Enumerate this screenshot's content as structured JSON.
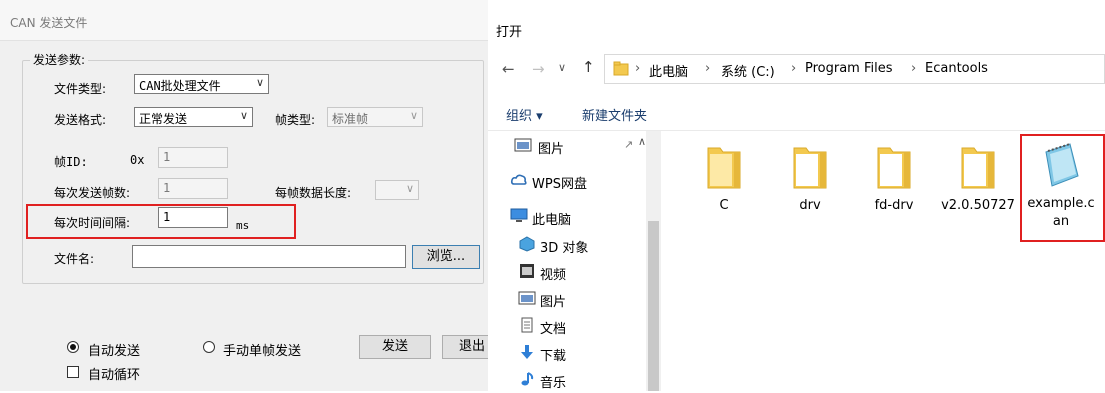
{
  "can_dialog": {
    "title": "CAN 发送文件",
    "group_title": "发送参数:",
    "file_type_label": "文件类型:",
    "file_type_value": "CAN批处理文件",
    "send_format_label": "发送格式:",
    "send_format_value": "正常发送",
    "frame_type_label": "帧类型:",
    "frame_type_value": "标准帧",
    "frame_id_label": "帧ID:",
    "frame_id_prefix": "0x",
    "frame_id_value": "1",
    "frames_per_send_label": "每次发送帧数:",
    "frames_per_send_value": "1",
    "frame_data_len_label": "每帧数据长度:",
    "interval_label": "每次时间间隔:",
    "interval_value": "1",
    "interval_unit": "ms",
    "filename_label": "文件名:",
    "filename_value": "",
    "browse_label": "浏览...",
    "auto_send_label": "自动发送",
    "manual_send_label": "手动单帧发送",
    "auto_loop_label": "自动循环",
    "send_button": "发送",
    "exit_button": "退出"
  },
  "open_dialog": {
    "title": "打开",
    "breadcrumb": [
      "此电脑",
      "系统 (C:)",
      "Program Files",
      "Ecantools"
    ],
    "organize_label": "组织 ▾",
    "new_folder_label": "新建文件夹",
    "nav_items": [
      {
        "label": "图片",
        "icon": "pictures-icon"
      },
      {
        "label": "WPS网盘",
        "icon": "cloud-icon"
      },
      {
        "label": "此电脑",
        "icon": "computer-icon"
      },
      {
        "label": "3D 对象",
        "icon": "3d-objects-icon"
      },
      {
        "label": "视频",
        "icon": "video-icon"
      },
      {
        "label": "图片",
        "icon": "pictures-icon"
      },
      {
        "label": "文档",
        "icon": "documents-icon"
      },
      {
        "label": "下载",
        "icon": "downloads-icon"
      },
      {
        "label": "音乐",
        "icon": "music-icon"
      }
    ],
    "files": [
      {
        "name": "C",
        "type": "folder"
      },
      {
        "name": "drv",
        "type": "folder"
      },
      {
        "name": "fd-drv",
        "type": "folder"
      },
      {
        "name": "v2.0.50727",
        "type": "folder"
      },
      {
        "name_line1": "example.c",
        "name_line2": "an",
        "type": "file"
      }
    ]
  },
  "colors": {
    "highlight_red": "#e02020",
    "folder_yellow": "#f3c94f",
    "link_blue": "#1a5fb4"
  }
}
